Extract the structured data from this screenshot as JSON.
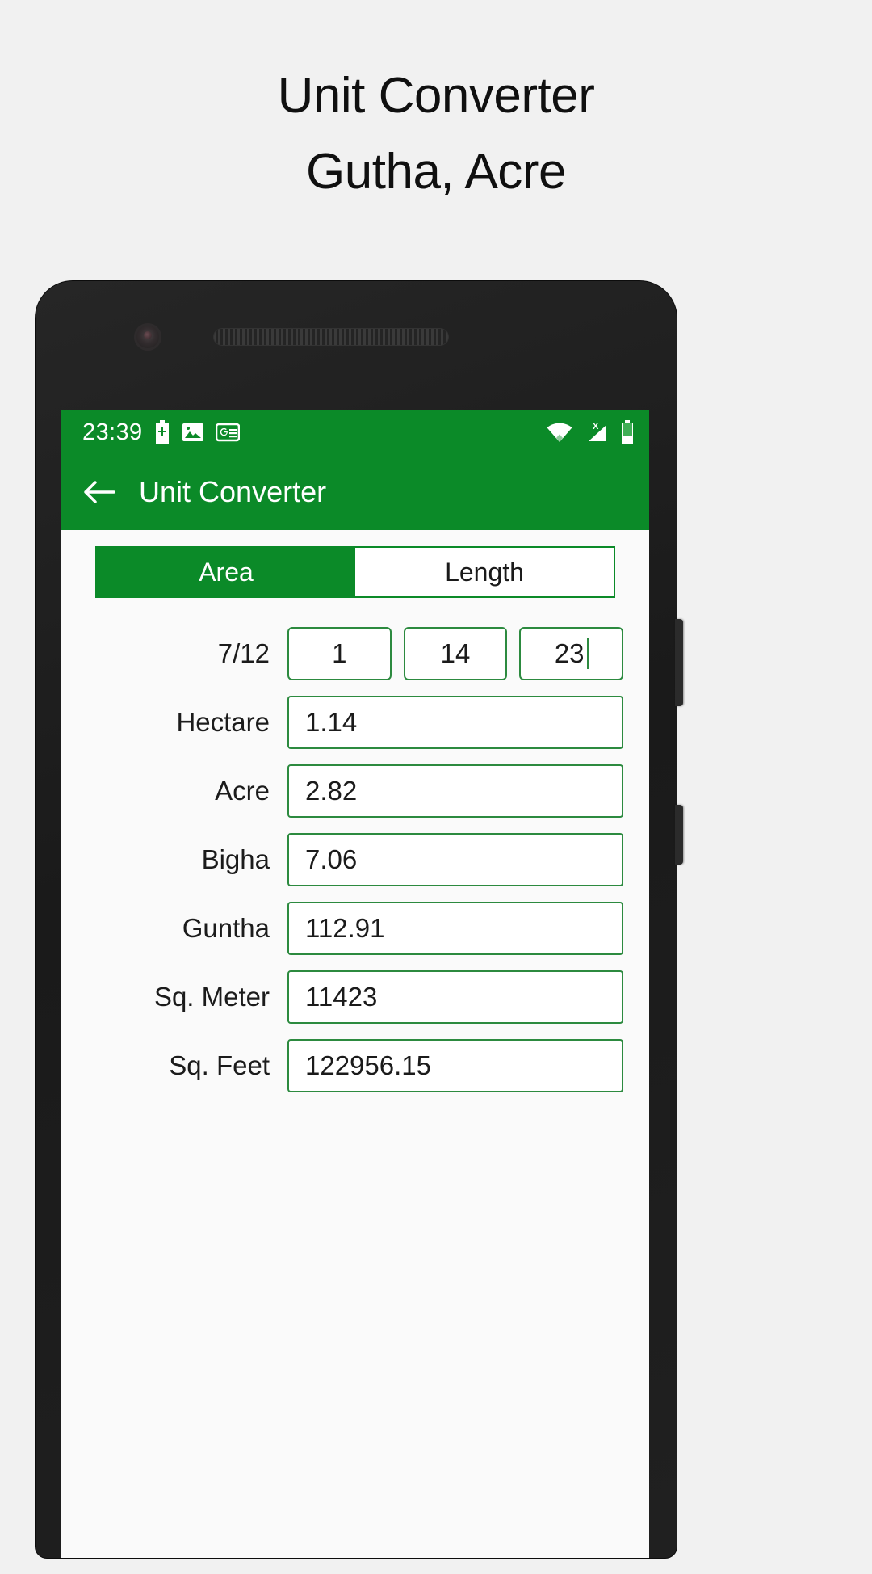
{
  "promo": {
    "title_line1": "Unit Converter",
    "title_line2": "Gutha, Acre"
  },
  "colors": {
    "brand_green": "#0b8a28",
    "field_border": "#2c8a3f",
    "screen_bg": "#fafafa",
    "page_bg": "#f1f1f1"
  },
  "statusbar": {
    "time": "23:39",
    "left_icons": [
      "battery-plus-icon",
      "image-icon",
      "google-news-icon"
    ],
    "right_icons": [
      "wifi-icon",
      "no-sim-signal-icon",
      "battery-icon"
    ]
  },
  "appbar": {
    "back_icon": "arrow-left-icon",
    "title": "Unit Converter"
  },
  "tabs": [
    {
      "label": "Area",
      "selected": true
    },
    {
      "label": "Length",
      "selected": false
    }
  ],
  "form": {
    "split_row": {
      "label": "7/12",
      "fields": [
        {
          "value": "1",
          "focused": false
        },
        {
          "value": "14",
          "focused": false
        },
        {
          "value": "23",
          "focused": true
        }
      ]
    },
    "rows": [
      {
        "label": "Hectare",
        "value": "1.14"
      },
      {
        "label": "Acre",
        "value": "2.82"
      },
      {
        "label": "Bigha",
        "value": "7.06"
      },
      {
        "label": "Guntha",
        "value": "112.91"
      },
      {
        "label": "Sq. Meter",
        "value": "11423"
      },
      {
        "label": "Sq. Feet",
        "value": "122956.15"
      }
    ]
  }
}
